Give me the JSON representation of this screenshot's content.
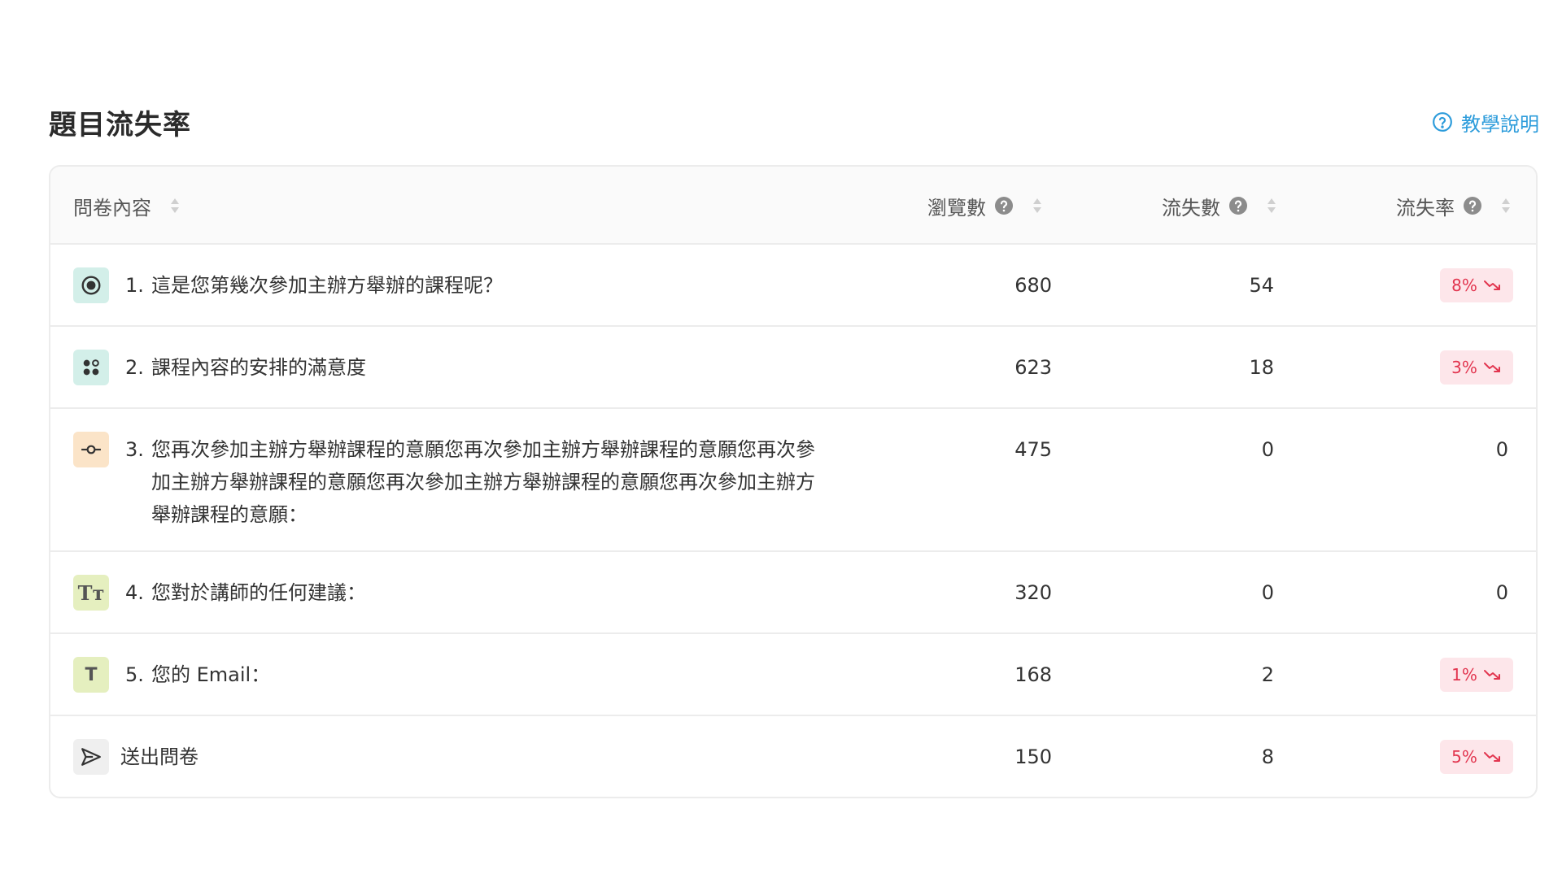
{
  "header": {
    "title": "題目流失率",
    "help_label": "教學說明"
  },
  "table": {
    "columns": {
      "content": "問卷內容",
      "views": "瀏覽數",
      "lost": "流失數",
      "rate": "流失率"
    },
    "rows": [
      {
        "num": "1.",
        "text": "這是您第幾次參加主辦方舉辦的課程呢？",
        "views": "680",
        "lost": "54",
        "rate": "8%",
        "icon": "radio-icon"
      },
      {
        "num": "2.",
        "text": "課程內容的安排的滿意度",
        "views": "623",
        "lost": "18",
        "rate": "3%",
        "icon": "rating-icon"
      },
      {
        "num": "3.",
        "text": "您再次參加主辦方舉辦課程的意願您再次參加主辦方舉辦課程的意願您再次參加主辦方舉辦課程的意願您再次參加主辦方舉辦課程的意願您再次參加主辦方舉辦課程的意願：",
        "views": "475",
        "lost": "0",
        "rate": "0",
        "icon": "slider-icon"
      },
      {
        "num": "4.",
        "text": "您對於講師的任何建議：",
        "views": "320",
        "lost": "0",
        "rate": "0",
        "icon": "long-text-icon",
        "icon_glyph": "Tт"
      },
      {
        "num": "5.",
        "text": "您的 Email：",
        "views": "168",
        "lost": "2",
        "rate": "1%",
        "icon": "short-text-icon",
        "icon_glyph": "T"
      },
      {
        "num": "",
        "text": "送出問卷",
        "views": "150",
        "lost": "8",
        "rate": "5%",
        "icon": "send-icon"
      }
    ]
  },
  "colors": {
    "accent": "#2d9cdb",
    "rate_badge_bg": "#fde6ea",
    "rate_badge_text": "#e2354f"
  }
}
